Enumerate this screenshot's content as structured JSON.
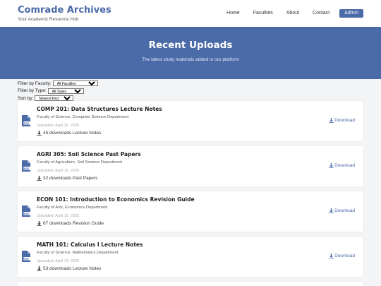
{
  "header": {
    "brand_title": "Comrade Archives",
    "brand_tagline": "Your Academic Resource Hub",
    "nav": [
      "Home",
      "Faculties",
      "About",
      "Contact"
    ],
    "admin_label": "Admin"
  },
  "hero": {
    "title": "Recent Uploads",
    "subtitle": "The latest study materials added to our platform"
  },
  "filters": {
    "faculty_label": "Filter by Faculty:",
    "faculty_value": "All Faculties",
    "type_label": "Filter by Type:",
    "type_value": "All Types",
    "sort_label": "Sort by:",
    "sort_value": "Newest First"
  },
  "uploads": [
    {
      "title": "COMP 201: Data Structures Lecture Notes",
      "department": "Faculty of Science, Computer Science Department",
      "date": "Uploaded: April 20, 2025",
      "stats": "45 downloads Lecture Notes",
      "download_label": "Download"
    },
    {
      "title": "AGRI 305: Soil Science Past Papers",
      "department": "Faculty of Agriculture, Soil Science Department",
      "date": "Uploaded: April 18, 2025",
      "stats": "32 downloads Past Papers",
      "download_label": "Download"
    },
    {
      "title": "ECON 101: Introduction to Economics Revision Guide",
      "department": "Faculty of Arts, Economics Department",
      "date": "Uploaded: April 15, 2025",
      "stats": "67 downloads Revision Guide",
      "download_label": "Download"
    },
    {
      "title": "MATH 101: Calculus I Lecture Notes",
      "department": "Faculty of Science, Mathematics Department",
      "date": "Uploaded: April 14, 2025",
      "stats": "53 downloads Lecture Notes",
      "download_label": "Download"
    }
  ],
  "icons": {
    "file": "file-pdf-icon",
    "download": "download-icon"
  },
  "colors": {
    "accent": "#4a6aa8",
    "page_bg": "#f3f4f6"
  }
}
